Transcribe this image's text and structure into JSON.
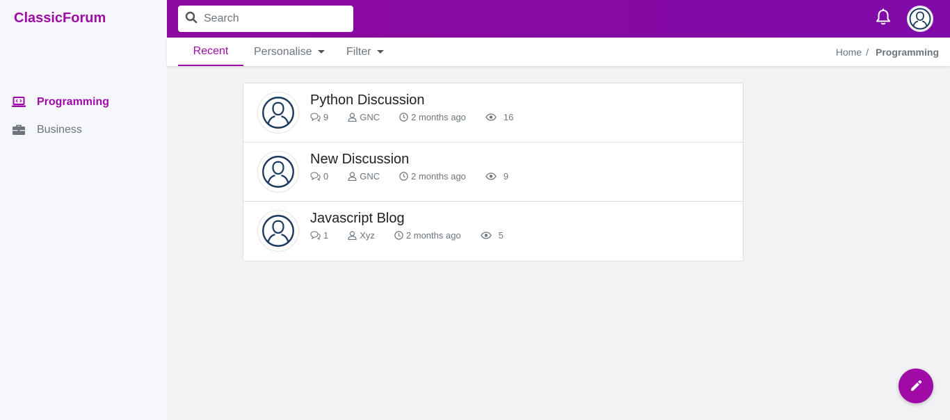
{
  "brand": "ClassicForum",
  "search": {
    "placeholder": "Search"
  },
  "sidebar": {
    "items": [
      {
        "label": "Programming",
        "icon": "laptop-code-icon",
        "active": true
      },
      {
        "label": "Business",
        "icon": "briefcase-icon",
        "active": false
      }
    ]
  },
  "tabs": [
    {
      "label": "Recent",
      "active": true
    },
    {
      "label": "Personalise",
      "dropdown": true
    },
    {
      "label": "Filter",
      "dropdown": true
    }
  ],
  "breadcrumb": {
    "home": "Home",
    "separator": "/",
    "current": "Programming"
  },
  "discussions": [
    {
      "title": "Python Discussion",
      "comments": "9",
      "author": "GNC",
      "time": "2 months ago",
      "views": "16"
    },
    {
      "title": "New Discussion",
      "comments": "0",
      "author": "GNC",
      "time": "2 months ago",
      "views": "9"
    },
    {
      "title": "Javascript Blog",
      "comments": "1",
      "author": "Xyz",
      "time": "2 months ago",
      "views": "5"
    }
  ],
  "colors": {
    "accent": "#a00aa7",
    "header": "#8a0aa2",
    "text_muted": "#6c757d",
    "avatar_stroke": "#1c3a5e"
  }
}
